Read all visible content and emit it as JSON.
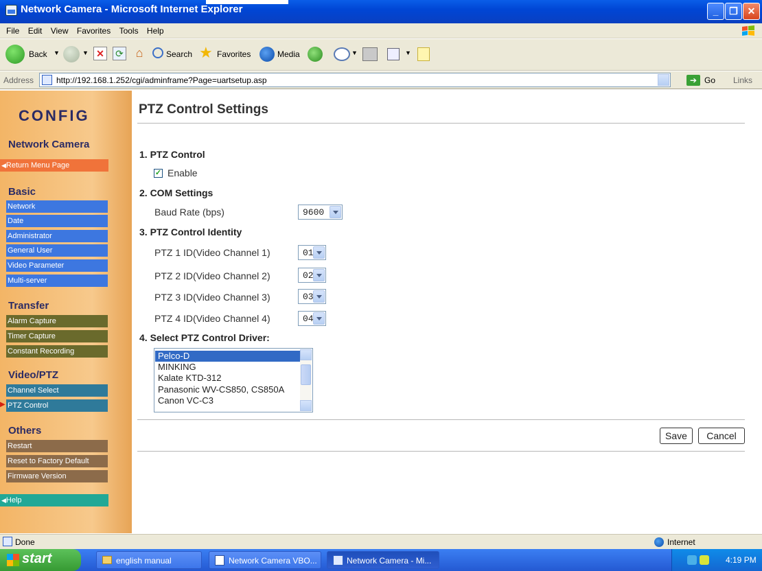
{
  "window": {
    "title": "Network Camera - Microsoft Internet Explorer"
  },
  "menubar": [
    "File",
    "Edit",
    "View",
    "Favorites",
    "Tools",
    "Help"
  ],
  "toolbar": {
    "back": "Back",
    "search": "Search",
    "favorites": "Favorites",
    "media": "Media"
  },
  "address": {
    "label": "Address",
    "url": "http://192.168.1.252/cgi/adminframe?Page=uartsetup.asp",
    "go": "Go",
    "links": "Links"
  },
  "sidebar": {
    "logo": "CONFIG",
    "subtitle": "Network Camera",
    "return": "Return Menu Page",
    "basic": {
      "heading": "Basic",
      "items": [
        "Network",
        "Date",
        "Administrator",
        "General User",
        "Video Parameter",
        "Multi-server"
      ]
    },
    "transfer": {
      "heading": "Transfer",
      "items": [
        "Alarm Capture",
        "Timer Capture",
        "Constant Recording"
      ]
    },
    "video": {
      "heading": "Video/PTZ",
      "items": [
        "Channel Select",
        "PTZ Control"
      ]
    },
    "others": {
      "heading": "Others",
      "items": [
        "Restart",
        "Reset to Factory Default",
        "Firmware Version"
      ]
    },
    "help": "Help"
  },
  "page": {
    "title": "PTZ Control Settings",
    "s1": "1. PTZ Control",
    "enable_label": "Enable",
    "enable_checked": true,
    "s2": "2. COM Settings",
    "baud_label": "Baud Rate (bps)",
    "baud_value": "9600",
    "s3": "3. PTZ Control Identity",
    "ptz": [
      {
        "label": "PTZ 1 ID(Video Channel 1)",
        "value": "01"
      },
      {
        "label": "PTZ 2 ID(Video Channel 2)",
        "value": "02"
      },
      {
        "label": "PTZ 3 ID(Video Channel 3)",
        "value": "03"
      },
      {
        "label": "PTZ 4 ID(Video Channel 4)",
        "value": "04"
      }
    ],
    "s4": "4. Select PTZ Control Driver:",
    "drivers": [
      "Pelco-D",
      "MINKING",
      "Kalate KTD-312",
      "Panasonic WV-CS850, CS850A",
      "Canon VC-C3"
    ],
    "save": "Save",
    "cancel": "Cancel"
  },
  "status": {
    "left": "Done",
    "zone": "Internet"
  },
  "taskbar": {
    "start": "start",
    "tasks": [
      "english manual",
      "Network Camera VBO...",
      "Network Camera - Mi..."
    ],
    "clock": "4:19 PM"
  }
}
